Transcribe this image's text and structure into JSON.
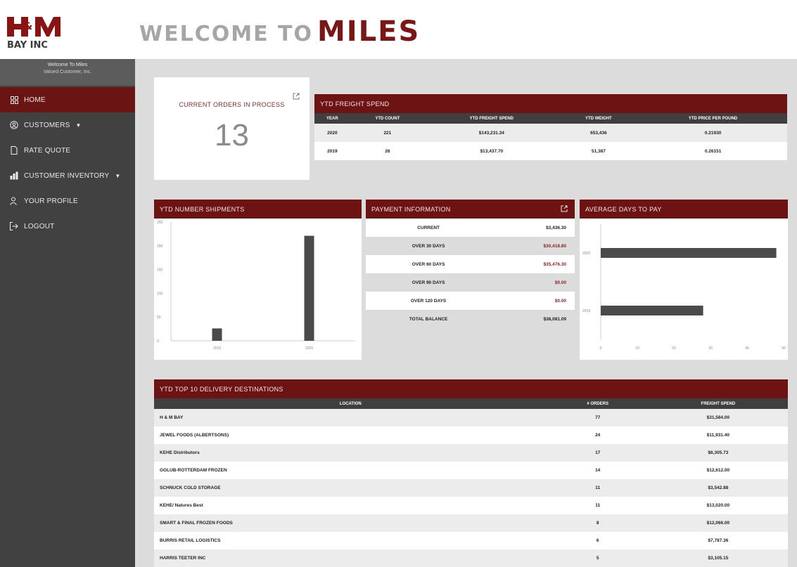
{
  "brand": {
    "logo_top": "H&M",
    "logo_bottom": "BAY INC",
    "welcome_prefix": "WELCOME TO",
    "welcome_name": "MILES",
    "accent": "#6e1313"
  },
  "sidebar": {
    "welcome_line": "Welcome To Miles",
    "customer_line": "Valued Customer, Inc.",
    "items": [
      {
        "label": "HOME",
        "icon": "grid-icon",
        "active": true
      },
      {
        "label": "CUSTOMERS",
        "icon": "user-circle-icon",
        "caret": "▼"
      },
      {
        "label": "RATE QUOTE",
        "icon": "document-icon"
      },
      {
        "label": "CUSTOMER INVENTORY",
        "icon": "inventory-icon",
        "caret": "▼"
      },
      {
        "label": "YOUR PROFILE",
        "icon": "profile-icon"
      },
      {
        "label": "LOGOUT",
        "icon": "logout-icon"
      }
    ]
  },
  "orders": {
    "label": "CURRENT ORDERS IN PROCESS",
    "count": "13"
  },
  "freight": {
    "title": "YTD FREIGHT SPEND",
    "headers": [
      "YEAR",
      "YTD COUNT",
      "YTD FREIGHT SPEND",
      "YTD WEIGHT",
      "YTD PRICE PER POUND"
    ],
    "rows": [
      [
        "2020",
        "221",
        "$143,231.34",
        "653,436",
        "0.21930"
      ],
      [
        "2019",
        "26",
        "$13,437.70",
        "51,387",
        "0.26151"
      ]
    ]
  },
  "shipments": {
    "title": "YTD NUMBER SHIPMENTS"
  },
  "payment": {
    "title": "PAYMENT INFORMATION",
    "rows": [
      {
        "label": "CURRENT",
        "value": "$3,436.30",
        "red": false
      },
      {
        "label": "OVER 30 DAYS",
        "value": "$30,418.80",
        "red": true
      },
      {
        "label": "OVER 60 DAYS",
        "value": "$35,476.30",
        "red": true
      },
      {
        "label": "OVER 90 DAYS",
        "value": "$0.00",
        "red": true
      },
      {
        "label": "OVER 120 DAYS",
        "value": "$0.00",
        "red": true
      },
      {
        "label": "TOTAL BALANCE",
        "value": "$38,081.09",
        "red": false
      }
    ]
  },
  "avgdays": {
    "title": "AVERAGE DAYS TO PAY"
  },
  "destinations": {
    "title": "YTD TOP 10 DELIVERY DESTINATIONS",
    "headers": [
      "LOCATION",
      "# ORDERS",
      "FREIGHT SPEND"
    ],
    "rows": [
      [
        "H & M BAY",
        "77",
        "$31,584.00"
      ],
      [
        "JEWEL FOODS (ALBERTSONS)",
        "24",
        "$11,931.40"
      ],
      [
        "KEHE Distributors",
        "17",
        "$6,305.73"
      ],
      [
        "GOLUB-ROTTERDAM FROZEN",
        "14",
        "$12,612.00"
      ],
      [
        "SCHNUCK COLD STORAGE",
        "11",
        "$3,542.88"
      ],
      [
        "KEHE/ Natures Best",
        "11",
        "$13,020.00"
      ],
      [
        "SMART & FINAL FROZEN FOODS",
        "8",
        "$12,066.00"
      ],
      [
        "BURRIS RETAIL LOGISTICS",
        "6",
        "$7,787.36"
      ],
      [
        "HARRIS TEETER INC",
        "5",
        "$3,105.15"
      ]
    ]
  },
  "chart_data": [
    {
      "type": "bar",
      "title": "YTD NUMBER SHIPMENTS",
      "categories": [
        "2019",
        "2020"
      ],
      "values": [
        26,
        221
      ],
      "ylim": [
        0,
        250
      ],
      "yticks": [
        0,
        50,
        100,
        150,
        200,
        250
      ],
      "orientation": "vertical",
      "bar_color": "#4a4a4a"
    },
    {
      "type": "bar",
      "title": "AVERAGE DAYS TO PAY",
      "categories": [
        "2020",
        "2019"
      ],
      "values": [
        48,
        28
      ],
      "xlim": [
        0,
        50
      ],
      "xticks": [
        0,
        10,
        20,
        30,
        40,
        50
      ],
      "orientation": "horizontal",
      "bar_color": "#4a4a4a"
    }
  ]
}
